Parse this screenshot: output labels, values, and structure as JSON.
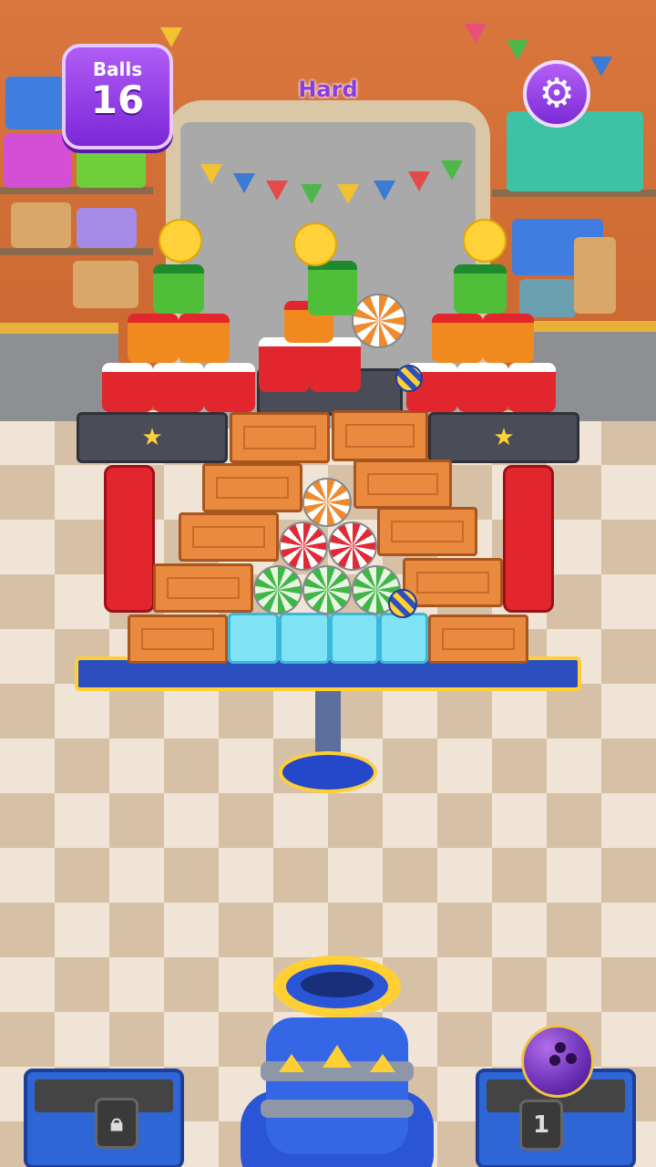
{
  "hud": {
    "balls_label": "Balls",
    "balls_count": "16",
    "difficulty": "Hard",
    "settings_icon": "gear-icon"
  },
  "slots": {
    "left_locked": true,
    "right_count": "1",
    "right_item": "bowling-ball"
  },
  "colors": {
    "hud_purple": "#8b3ce0",
    "crate_orange": "#e98a3e",
    "jar_red": "#e2262d",
    "ice_blue": "#7fe3f5",
    "platform_blue": "#2c4fbf"
  }
}
